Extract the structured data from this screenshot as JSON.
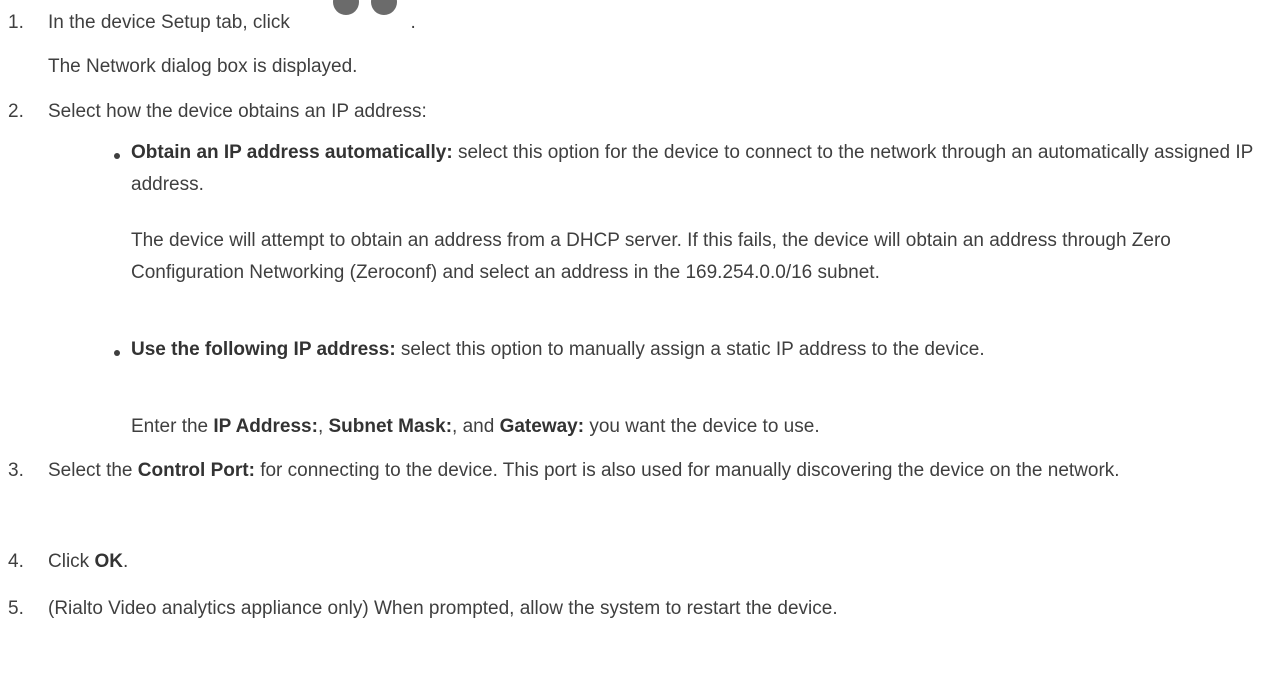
{
  "steps": [
    {
      "number": "1.",
      "text_before": "In the device Setup tab, click",
      "icon": "network-settings-icon",
      "text_after": ".",
      "result": "The Network dialog box is displayed."
    },
    {
      "number": "2.",
      "text": "Select how the device obtains an IP address:",
      "options": [
        {
          "label": "Obtain an IP address automatically:",
          "text": " select this option for the device to connect to the network through an automatically assigned IP address.",
          "detail": "The device will attempt to obtain an address from a DHCP server. If this fails, the device will obtain an address through Zero Configuration Networking (Zeroconf) and select an address in the 169.254.0.0/16 subnet."
        },
        {
          "label": "Use the following IP address:",
          "text": " select this option to manually assign a static IP address to the device.",
          "detail_parts": {
            "p1": "Enter the ",
            "b1": "IP Address:",
            "p2": ", ",
            "b2": "Subnet Mask:",
            "p3": ", and ",
            "b3": "Gateway:",
            "p4": " you want the device to use."
          }
        }
      ]
    },
    {
      "number": "3.",
      "text_before": "Select the ",
      "bold": "Control Port:",
      "text_after": " for connecting to the device. This port is also used for manually discovering the device on the network."
    },
    {
      "number": "4.",
      "text_before": "Click ",
      "bold": "OK",
      "text_after": "."
    },
    {
      "number": "5.",
      "text": "(Rialto Video analytics appliance only) When prompted, allow the system to restart the device."
    }
  ]
}
